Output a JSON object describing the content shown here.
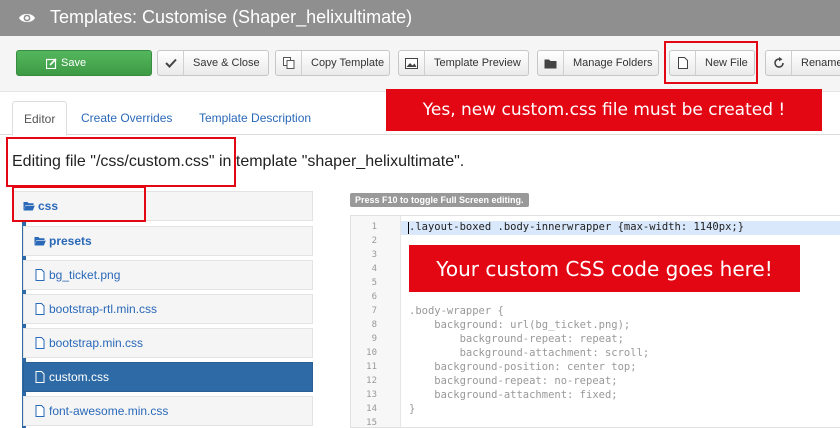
{
  "window": {
    "title": "Templates: Customise (Shaper_helixultimate)"
  },
  "toolbar": {
    "save": "Save",
    "save_close": "Save & Close",
    "copy_template": "Copy Template",
    "template_preview": "Template Preview",
    "manage_folders": "Manage Folders",
    "new_file": "New File",
    "rename": "Rename"
  },
  "tabs": {
    "editor": "Editor",
    "create_overrides": "Create Overrides",
    "template_description": "Template Description"
  },
  "callouts": {
    "new_file_note": "Yes, new custom.css file must be created !",
    "code_note": "Your custom CSS code goes here!"
  },
  "editing": {
    "prefix": "Editing file ",
    "file": "\"/css/custom.css\"",
    "middle": " in template ",
    "template": "\"shaper_helixultimate\"",
    "suffix": "."
  },
  "file_tree": {
    "root": "css",
    "items": [
      {
        "label": "presets",
        "type": "folder"
      },
      {
        "label": "bg_ticket.png",
        "type": "file"
      },
      {
        "label": "bootstrap-rtl.min.css",
        "type": "file"
      },
      {
        "label": "bootstrap.min.css",
        "type": "file"
      },
      {
        "label": "custom.css",
        "type": "file",
        "selected": true
      },
      {
        "label": "font-awesome.min.css",
        "type": "file"
      }
    ]
  },
  "editor": {
    "hint": "Press F10 to toggle Full Screen editing.",
    "line_numbers": [
      "1",
      "2",
      "3",
      "4",
      "5",
      "6",
      "7",
      "8",
      "9",
      "10",
      "11",
      "12",
      "13",
      "14",
      "15"
    ],
    "lines": [
      ".layout-boxed .body-innerwrapper {max-width: 1140px;}",
      "",
      "",
      "",
      "",
      "",
      ".body-wrapper {",
      "    background: url(bg_ticket.png);",
      "        background-repeat: repeat;",
      "        background-attachment: scroll;",
      "    background-position: center top;",
      "    background-repeat: no-repeat;",
      "    background-attachment: fixed;",
      "}",
      ""
    ]
  },
  "colors": {
    "accent_red": "#e30613",
    "selected_blue": "#2e6ba6",
    "save_green": "#46a94f",
    "link_blue": "#2a69b8"
  }
}
